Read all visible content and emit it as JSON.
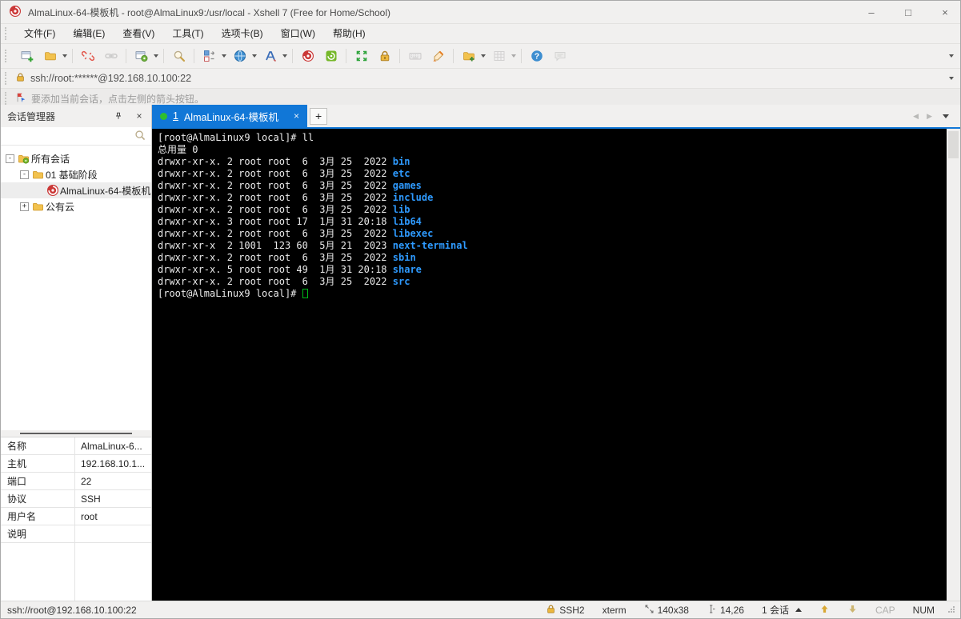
{
  "window": {
    "title": "AlmaLinux-64-模板机 - root@AlmaLinux9:/usr/local - Xshell 7 (Free for Home/School)",
    "minimize": "–",
    "maximize": "□",
    "close": "×"
  },
  "menu": {
    "items": [
      "文件(F)",
      "编辑(E)",
      "查看(V)",
      "工具(T)",
      "选项卡(B)",
      "窗口(W)",
      "帮助(H)"
    ]
  },
  "toolbar": {
    "buttons": [
      {
        "icon": "new-session"
      },
      {
        "icon": "open-folder",
        "dropdown": true
      },
      {
        "sep": true
      },
      {
        "icon": "disconnect"
      },
      {
        "icon": "reconnect",
        "disabled": true
      },
      {
        "sep": true
      },
      {
        "icon": "session-properties",
        "dropdown": true
      },
      {
        "sep": true
      },
      {
        "icon": "find"
      },
      {
        "sep": true
      },
      {
        "icon": "layout",
        "dropdown": true
      },
      {
        "icon": "proxy-globe",
        "dropdown": true
      },
      {
        "icon": "font",
        "dropdown": true
      },
      {
        "sep": true
      },
      {
        "icon": "xshell"
      },
      {
        "icon": "xftp"
      },
      {
        "sep": true
      },
      {
        "icon": "fullscreen"
      },
      {
        "icon": "lock"
      },
      {
        "sep": true
      },
      {
        "icon": "keyboard",
        "disabled": true
      },
      {
        "icon": "highlight"
      },
      {
        "sep": true
      },
      {
        "icon": "new-folder",
        "dropdown": true
      },
      {
        "icon": "grid",
        "disabled": true,
        "dropdown": true
      },
      {
        "sep": true
      },
      {
        "icon": "help"
      },
      {
        "icon": "chat",
        "disabled": true
      }
    ]
  },
  "address_bar": {
    "url": "ssh://root:******@192.168.10.100:22"
  },
  "info_bar": {
    "text": "要添加当前会话，点击左侧的箭头按钮。"
  },
  "session_manager": {
    "title": "会话管理器",
    "search_placeholder": "",
    "tree": [
      {
        "level": 0,
        "expander": "minus",
        "icon": "folder-all",
        "label": "所有会话"
      },
      {
        "level": 1,
        "expander": "minus",
        "icon": "folder",
        "label": "01 基础阶段"
      },
      {
        "level": 2,
        "expander": "none",
        "icon": "xshell-session",
        "label": "AlmaLinux-64-模板机",
        "selected": true
      },
      {
        "level": 1,
        "expander": "plus",
        "icon": "folder",
        "label": "公有云"
      }
    ],
    "properties": [
      {
        "label": "名称",
        "value": "AlmaLinux-6..."
      },
      {
        "label": "主机",
        "value": "192.168.10.1..."
      },
      {
        "label": "端口",
        "value": "22"
      },
      {
        "label": "协议",
        "value": "SSH"
      },
      {
        "label": "用户名",
        "value": "root"
      },
      {
        "label": "说明",
        "value": ""
      }
    ]
  },
  "tab_bar": {
    "tabs": [
      {
        "number": "1",
        "title": "AlmaLinux-64-模板机",
        "connected": true,
        "close": "×"
      }
    ],
    "new_tab": "+"
  },
  "terminal": {
    "lines": [
      [
        {
          "t": "[root@AlmaLinux9 local]# ll"
        }
      ],
      [
        {
          "t": "总用量 0"
        }
      ],
      [
        {
          "t": "drwxr-xr-x. 2 root root  6  3月 25  2022 "
        },
        {
          "t": "bin",
          "c": "dir"
        }
      ],
      [
        {
          "t": "drwxr-xr-x. 2 root root  6  3月 25  2022 "
        },
        {
          "t": "etc",
          "c": "dir"
        }
      ],
      [
        {
          "t": "drwxr-xr-x. 2 root root  6  3月 25  2022 "
        },
        {
          "t": "games",
          "c": "dir"
        }
      ],
      [
        {
          "t": "drwxr-xr-x. 2 root root  6  3月 25  2022 "
        },
        {
          "t": "include",
          "c": "dir"
        }
      ],
      [
        {
          "t": "drwxr-xr-x. 2 root root  6  3月 25  2022 "
        },
        {
          "t": "lib",
          "c": "dir"
        }
      ],
      [
        {
          "t": "drwxr-xr-x. 3 root root 17  1月 31 20:18 "
        },
        {
          "t": "lib64",
          "c": "dir"
        }
      ],
      [
        {
          "t": "drwxr-xr-x. 2 root root  6  3月 25  2022 "
        },
        {
          "t": "libexec",
          "c": "dir"
        }
      ],
      [
        {
          "t": "drwxr-xr-x  2 1001  123 60  5月 21  2023 "
        },
        {
          "t": "next-terminal",
          "c": "dir"
        }
      ],
      [
        {
          "t": "drwxr-xr-x. 2 root root  6  3月 25  2022 "
        },
        {
          "t": "sbin",
          "c": "dir"
        }
      ],
      [
        {
          "t": "drwxr-xr-x. 5 root root 49  1月 31 20:18 "
        },
        {
          "t": "share",
          "c": "dir"
        }
      ],
      [
        {
          "t": "drwxr-xr-x. 2 root root  6  3月 25  2022 "
        },
        {
          "t": "src",
          "c": "dir"
        }
      ],
      [
        {
          "t": "[root@AlmaLinux9 local]# "
        },
        {
          "cursor": true
        }
      ]
    ]
  },
  "status_bar": {
    "left": "ssh://root@192.168.10.100:22",
    "items": [
      {
        "icon": "lock-small",
        "text": "SSH2"
      },
      {
        "text": "xterm"
      },
      {
        "icon": "resize",
        "text": "140x38"
      },
      {
        "icon": "caret-pos",
        "text": "14,26"
      },
      {
        "text": "1 会话",
        "caret": "up"
      },
      {
        "icon": "arrow-up"
      },
      {
        "icon": "arrow-down"
      },
      {
        "text": "CAP",
        "dim": true
      },
      {
        "text": "NUM"
      }
    ]
  },
  "colors": {
    "accent": "#1177d7",
    "terminal_dir": "#2e9aff",
    "cursor_green": "#00b818",
    "connected_green": "#2fbe2f",
    "lock_gold": "#d9a733",
    "info_gray": "#9b9b9b"
  }
}
